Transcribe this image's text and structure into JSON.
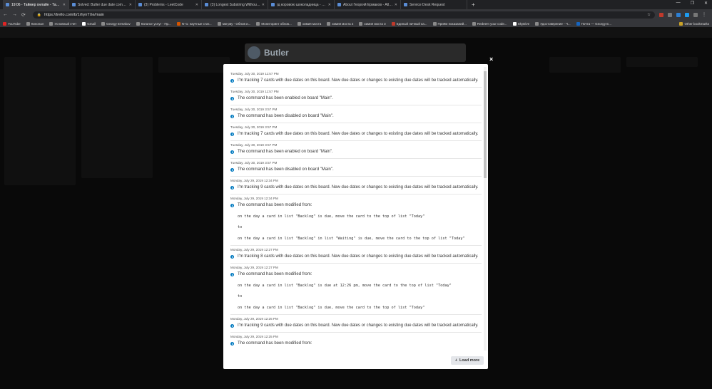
{
  "browser": {
    "tabs": [
      {
        "label": "19:06 - Таймер онлайн - Тайм..."
      },
      {
        "label": "Solved: Butler due date comma..."
      },
      {
        "label": "(3) Problems - LeetCode"
      },
      {
        "label": "(3) Longest Substring Without R..."
      },
      {
        "label": "гд коровою шоколадница - Go..."
      },
      {
        "label": "About Георгий Ермаков - Atlas..."
      },
      {
        "label": "Service Desk Request"
      }
    ],
    "newtab": "+",
    "window_controls": {
      "min": "—",
      "max": "❐",
      "close": "✕"
    },
    "url": "https://trello.com/b/1rhynTXe/main",
    "bookmarks": [
      "YouTube",
      "Кинопал",
      "Условный счет",
      "Gmail",
      "Georgy Ermakov",
      "Каталог услуг - Пр...",
      "N+1: научные стат...",
      "мм-рву - Обнов и...",
      "Мониторинг обнов...",
      "химия моста",
      "химия моста 2",
      "химия моста 3",
      "Единый личный ка...",
      "Приём показаний...",
      "Redeem your code...",
      "SkyDive",
      "Удостоверение - Ч...",
      "Почта — Georgy E..."
    ],
    "other_bookmarks": "Other bookmarks"
  },
  "butler": {
    "title": "Butler"
  },
  "modal": {
    "close": "×",
    "load_more": "Load more",
    "entries": [
      {
        "date": "Tuesday, July 30, 2019 11:57 PM",
        "message": "I'm tracking 7 cards with due dates on this board. New due dates or changes to existing due dates will be tracked automatically."
      },
      {
        "date": "Tuesday, July 30, 2019 11:57 PM",
        "message": "The command has been enabled on board \"Main\"."
      },
      {
        "date": "Tuesday, July 30, 2019 3:57 PM",
        "message": "The command has been disabled on board \"Main\"."
      },
      {
        "date": "Tuesday, July 30, 2019 3:57 PM",
        "message": "I'm tracking 7 cards with due dates on this board. New due dates or changes to existing due dates will be tracked automatically."
      },
      {
        "date": "Tuesday, July 30, 2019 3:57 PM",
        "message": "The command has been enabled on board \"Main\"."
      },
      {
        "date": "Tuesday, July 30, 2019 3:57 PM",
        "message": "The command has been disabled on board \"Main\"."
      },
      {
        "date": "Monday, July 29, 2019 12:34 PM",
        "message": "I'm tracking 9 cards with due dates on this board. New due dates or changes to existing due dates will be tracked automatically."
      },
      {
        "date": "Monday, July 29, 2019 12:34 PM",
        "message": "The command has been modified from:",
        "from": "on the day a card in list \"Backlog\" is due, move the card to the top of list \"Today\"",
        "to_label": "to",
        "to": "on the day a card in list \"Backlog\" in list \"Waiting\" is due, move the card to the top of list \"Today\""
      },
      {
        "date": "Monday, July 29, 2019 12:27 PM",
        "message": "I'm tracking 8 cards with due dates on this board. New due dates or changes to existing due dates will be tracked automatically."
      },
      {
        "date": "Monday, July 29, 2019 12:27 PM",
        "message": "The command has been modified from:",
        "from": "on the day a card in list \"Backlog\" is due at 12:26 pm, move the card to the top of list \"Today\"",
        "to_label": "to",
        "to": "on the day a card in list \"Backlog\" is due, move the card to the top of list \"Today\""
      },
      {
        "date": "Monday, July 29, 2019 12:25 PM",
        "message": "I'm tracking 9 cards with due dates on this board. New due dates or changes to existing due dates will be tracked automatically."
      },
      {
        "date": "Monday, July 29, 2019 12:25 PM",
        "message": "The command has been modified from:"
      }
    ]
  }
}
